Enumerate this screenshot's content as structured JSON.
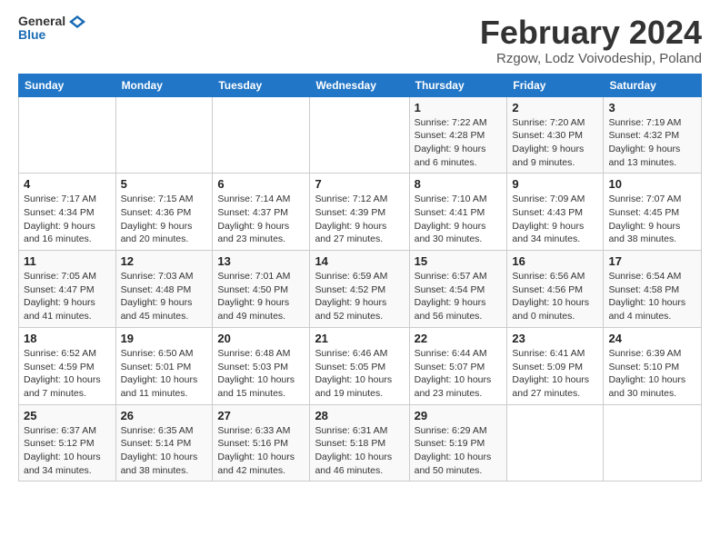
{
  "logo": {
    "general": "General",
    "blue": "Blue"
  },
  "header": {
    "month_year": "February 2024",
    "location": "Rzgow, Lodz Voivodeship, Poland"
  },
  "weekdays": [
    "Sunday",
    "Monday",
    "Tuesday",
    "Wednesday",
    "Thursday",
    "Friday",
    "Saturday"
  ],
  "weeks": [
    [
      {
        "day": "",
        "info": ""
      },
      {
        "day": "",
        "info": ""
      },
      {
        "day": "",
        "info": ""
      },
      {
        "day": "",
        "info": ""
      },
      {
        "day": "1",
        "info": "Sunrise: 7:22 AM\nSunset: 4:28 PM\nDaylight: 9 hours and 6 minutes."
      },
      {
        "day": "2",
        "info": "Sunrise: 7:20 AM\nSunset: 4:30 PM\nDaylight: 9 hours and 9 minutes."
      },
      {
        "day": "3",
        "info": "Sunrise: 7:19 AM\nSunset: 4:32 PM\nDaylight: 9 hours and 13 minutes."
      }
    ],
    [
      {
        "day": "4",
        "info": "Sunrise: 7:17 AM\nSunset: 4:34 PM\nDaylight: 9 hours and 16 minutes."
      },
      {
        "day": "5",
        "info": "Sunrise: 7:15 AM\nSunset: 4:36 PM\nDaylight: 9 hours and 20 minutes."
      },
      {
        "day": "6",
        "info": "Sunrise: 7:14 AM\nSunset: 4:37 PM\nDaylight: 9 hours and 23 minutes."
      },
      {
        "day": "7",
        "info": "Sunrise: 7:12 AM\nSunset: 4:39 PM\nDaylight: 9 hours and 27 minutes."
      },
      {
        "day": "8",
        "info": "Sunrise: 7:10 AM\nSunset: 4:41 PM\nDaylight: 9 hours and 30 minutes."
      },
      {
        "day": "9",
        "info": "Sunrise: 7:09 AM\nSunset: 4:43 PM\nDaylight: 9 hours and 34 minutes."
      },
      {
        "day": "10",
        "info": "Sunrise: 7:07 AM\nSunset: 4:45 PM\nDaylight: 9 hours and 38 minutes."
      }
    ],
    [
      {
        "day": "11",
        "info": "Sunrise: 7:05 AM\nSunset: 4:47 PM\nDaylight: 9 hours and 41 minutes."
      },
      {
        "day": "12",
        "info": "Sunrise: 7:03 AM\nSunset: 4:48 PM\nDaylight: 9 hours and 45 minutes."
      },
      {
        "day": "13",
        "info": "Sunrise: 7:01 AM\nSunset: 4:50 PM\nDaylight: 9 hours and 49 minutes."
      },
      {
        "day": "14",
        "info": "Sunrise: 6:59 AM\nSunset: 4:52 PM\nDaylight: 9 hours and 52 minutes."
      },
      {
        "day": "15",
        "info": "Sunrise: 6:57 AM\nSunset: 4:54 PM\nDaylight: 9 hours and 56 minutes."
      },
      {
        "day": "16",
        "info": "Sunrise: 6:56 AM\nSunset: 4:56 PM\nDaylight: 10 hours and 0 minutes."
      },
      {
        "day": "17",
        "info": "Sunrise: 6:54 AM\nSunset: 4:58 PM\nDaylight: 10 hours and 4 minutes."
      }
    ],
    [
      {
        "day": "18",
        "info": "Sunrise: 6:52 AM\nSunset: 4:59 PM\nDaylight: 10 hours and 7 minutes."
      },
      {
        "day": "19",
        "info": "Sunrise: 6:50 AM\nSunset: 5:01 PM\nDaylight: 10 hours and 11 minutes."
      },
      {
        "day": "20",
        "info": "Sunrise: 6:48 AM\nSunset: 5:03 PM\nDaylight: 10 hours and 15 minutes."
      },
      {
        "day": "21",
        "info": "Sunrise: 6:46 AM\nSunset: 5:05 PM\nDaylight: 10 hours and 19 minutes."
      },
      {
        "day": "22",
        "info": "Sunrise: 6:44 AM\nSunset: 5:07 PM\nDaylight: 10 hours and 23 minutes."
      },
      {
        "day": "23",
        "info": "Sunrise: 6:41 AM\nSunset: 5:09 PM\nDaylight: 10 hours and 27 minutes."
      },
      {
        "day": "24",
        "info": "Sunrise: 6:39 AM\nSunset: 5:10 PM\nDaylight: 10 hours and 30 minutes."
      }
    ],
    [
      {
        "day": "25",
        "info": "Sunrise: 6:37 AM\nSunset: 5:12 PM\nDaylight: 10 hours and 34 minutes."
      },
      {
        "day": "26",
        "info": "Sunrise: 6:35 AM\nSunset: 5:14 PM\nDaylight: 10 hours and 38 minutes."
      },
      {
        "day": "27",
        "info": "Sunrise: 6:33 AM\nSunset: 5:16 PM\nDaylight: 10 hours and 42 minutes."
      },
      {
        "day": "28",
        "info": "Sunrise: 6:31 AM\nSunset: 5:18 PM\nDaylight: 10 hours and 46 minutes."
      },
      {
        "day": "29",
        "info": "Sunrise: 6:29 AM\nSunset: 5:19 PM\nDaylight: 10 hours and 50 minutes."
      },
      {
        "day": "",
        "info": ""
      },
      {
        "day": "",
        "info": ""
      }
    ]
  ]
}
